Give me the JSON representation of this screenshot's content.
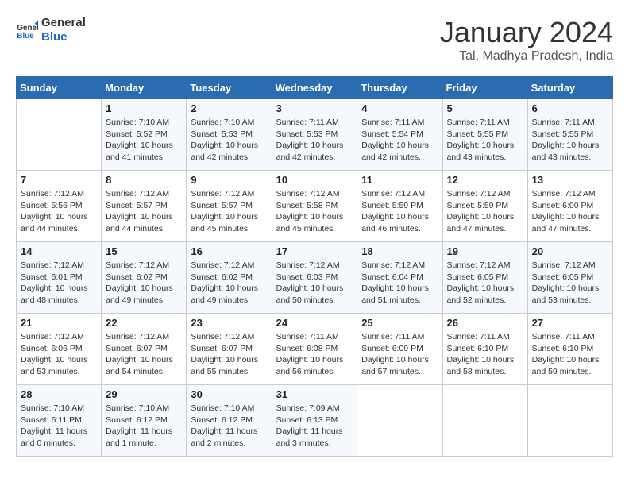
{
  "header": {
    "logo_line1": "General",
    "logo_line2": "Blue",
    "month": "January 2024",
    "location": "Tal, Madhya Pradesh, India"
  },
  "weekdays": [
    "Sunday",
    "Monday",
    "Tuesday",
    "Wednesday",
    "Thursday",
    "Friday",
    "Saturday"
  ],
  "weeks": [
    [
      {
        "day": "",
        "info": ""
      },
      {
        "day": "1",
        "info": "Sunrise: 7:10 AM\nSunset: 5:52 PM\nDaylight: 10 hours\nand 41 minutes."
      },
      {
        "day": "2",
        "info": "Sunrise: 7:10 AM\nSunset: 5:53 PM\nDaylight: 10 hours\nand 42 minutes."
      },
      {
        "day": "3",
        "info": "Sunrise: 7:11 AM\nSunset: 5:53 PM\nDaylight: 10 hours\nand 42 minutes."
      },
      {
        "day": "4",
        "info": "Sunrise: 7:11 AM\nSunset: 5:54 PM\nDaylight: 10 hours\nand 42 minutes."
      },
      {
        "day": "5",
        "info": "Sunrise: 7:11 AM\nSunset: 5:55 PM\nDaylight: 10 hours\nand 43 minutes."
      },
      {
        "day": "6",
        "info": "Sunrise: 7:11 AM\nSunset: 5:55 PM\nDaylight: 10 hours\nand 43 minutes."
      }
    ],
    [
      {
        "day": "7",
        "info": "Sunrise: 7:12 AM\nSunset: 5:56 PM\nDaylight: 10 hours\nand 44 minutes."
      },
      {
        "day": "8",
        "info": "Sunrise: 7:12 AM\nSunset: 5:57 PM\nDaylight: 10 hours\nand 44 minutes."
      },
      {
        "day": "9",
        "info": "Sunrise: 7:12 AM\nSunset: 5:57 PM\nDaylight: 10 hours\nand 45 minutes."
      },
      {
        "day": "10",
        "info": "Sunrise: 7:12 AM\nSunset: 5:58 PM\nDaylight: 10 hours\nand 45 minutes."
      },
      {
        "day": "11",
        "info": "Sunrise: 7:12 AM\nSunset: 5:59 PM\nDaylight: 10 hours\nand 46 minutes."
      },
      {
        "day": "12",
        "info": "Sunrise: 7:12 AM\nSunset: 5:59 PM\nDaylight: 10 hours\nand 47 minutes."
      },
      {
        "day": "13",
        "info": "Sunrise: 7:12 AM\nSunset: 6:00 PM\nDaylight: 10 hours\nand 47 minutes."
      }
    ],
    [
      {
        "day": "14",
        "info": "Sunrise: 7:12 AM\nSunset: 6:01 PM\nDaylight: 10 hours\nand 48 minutes."
      },
      {
        "day": "15",
        "info": "Sunrise: 7:12 AM\nSunset: 6:02 PM\nDaylight: 10 hours\nand 49 minutes."
      },
      {
        "day": "16",
        "info": "Sunrise: 7:12 AM\nSunset: 6:02 PM\nDaylight: 10 hours\nand 49 minutes."
      },
      {
        "day": "17",
        "info": "Sunrise: 7:12 AM\nSunset: 6:03 PM\nDaylight: 10 hours\nand 50 minutes."
      },
      {
        "day": "18",
        "info": "Sunrise: 7:12 AM\nSunset: 6:04 PM\nDaylight: 10 hours\nand 51 minutes."
      },
      {
        "day": "19",
        "info": "Sunrise: 7:12 AM\nSunset: 6:05 PM\nDaylight: 10 hours\nand 52 minutes."
      },
      {
        "day": "20",
        "info": "Sunrise: 7:12 AM\nSunset: 6:05 PM\nDaylight: 10 hours\nand 53 minutes."
      }
    ],
    [
      {
        "day": "21",
        "info": "Sunrise: 7:12 AM\nSunset: 6:06 PM\nDaylight: 10 hours\nand 53 minutes."
      },
      {
        "day": "22",
        "info": "Sunrise: 7:12 AM\nSunset: 6:07 PM\nDaylight: 10 hours\nand 54 minutes."
      },
      {
        "day": "23",
        "info": "Sunrise: 7:12 AM\nSunset: 6:07 PM\nDaylight: 10 hours\nand 55 minutes."
      },
      {
        "day": "24",
        "info": "Sunrise: 7:11 AM\nSunset: 6:08 PM\nDaylight: 10 hours\nand 56 minutes."
      },
      {
        "day": "25",
        "info": "Sunrise: 7:11 AM\nSunset: 6:09 PM\nDaylight: 10 hours\nand 57 minutes."
      },
      {
        "day": "26",
        "info": "Sunrise: 7:11 AM\nSunset: 6:10 PM\nDaylight: 10 hours\nand 58 minutes."
      },
      {
        "day": "27",
        "info": "Sunrise: 7:11 AM\nSunset: 6:10 PM\nDaylight: 10 hours\nand 59 minutes."
      }
    ],
    [
      {
        "day": "28",
        "info": "Sunrise: 7:10 AM\nSunset: 6:11 PM\nDaylight: 11 hours\nand 0 minutes."
      },
      {
        "day": "29",
        "info": "Sunrise: 7:10 AM\nSunset: 6:12 PM\nDaylight: 11 hours\nand 1 minute."
      },
      {
        "day": "30",
        "info": "Sunrise: 7:10 AM\nSunset: 6:12 PM\nDaylight: 11 hours\nand 2 minutes."
      },
      {
        "day": "31",
        "info": "Sunrise: 7:09 AM\nSunset: 6:13 PM\nDaylight: 11 hours\nand 3 minutes."
      },
      {
        "day": "",
        "info": ""
      },
      {
        "day": "",
        "info": ""
      },
      {
        "day": "",
        "info": ""
      }
    ]
  ]
}
